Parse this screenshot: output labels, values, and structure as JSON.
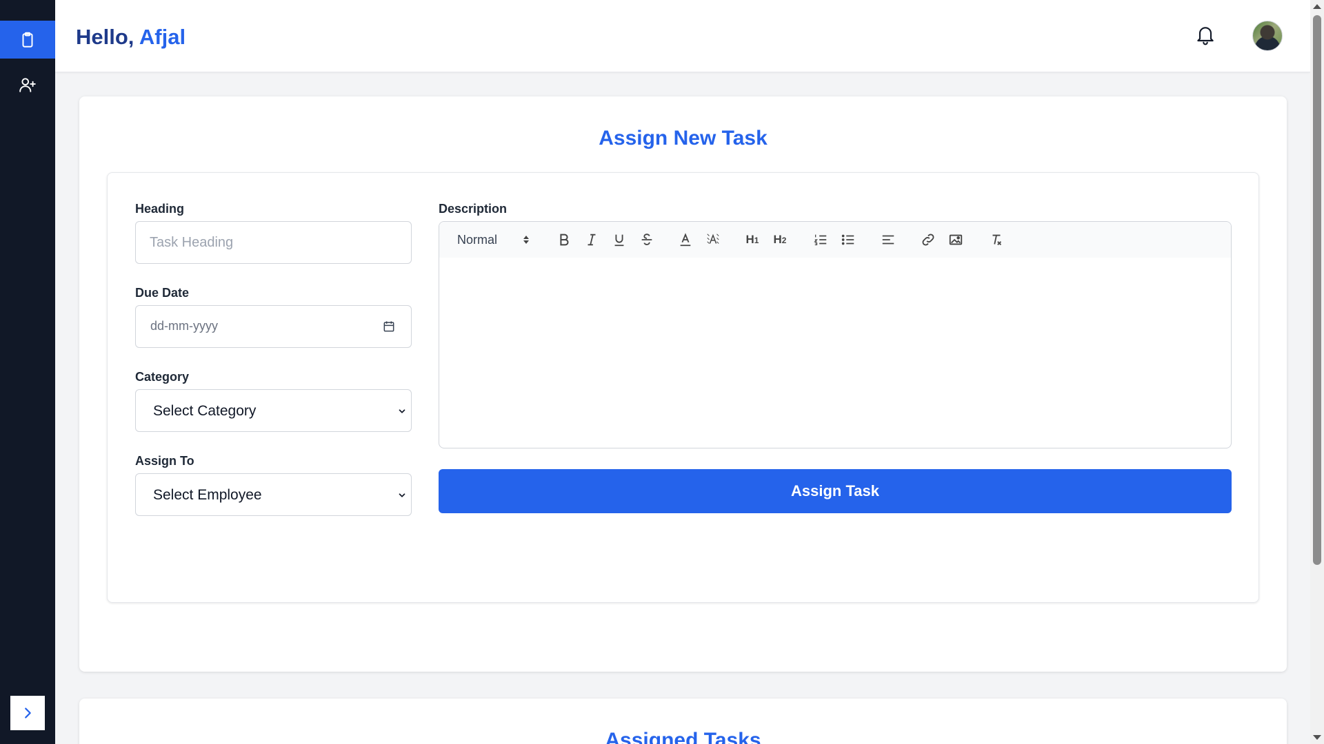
{
  "header": {
    "greeting_prefix": "Hello,",
    "user_name": "Afjal"
  },
  "sidebar": {
    "items": [
      {
        "name": "tasks",
        "icon": "clipboard-icon",
        "active": true
      },
      {
        "name": "add-user",
        "icon": "user-plus-icon",
        "active": false
      }
    ],
    "toggle_icon": "chevron-right-icon"
  },
  "form": {
    "title": "Assign New Task",
    "heading": {
      "label": "Heading",
      "placeholder": "Task Heading",
      "value": ""
    },
    "due_date": {
      "label": "Due Date",
      "placeholder": "dd-mm-yyyy"
    },
    "category": {
      "label": "Category",
      "selected": "Select Category"
    },
    "assign_to": {
      "label": "Assign To",
      "selected": "Select Employee"
    },
    "description": {
      "label": "Description",
      "toolbar": {
        "format": "Normal",
        "buttons": [
          "bold",
          "italic",
          "underline",
          "strike",
          "color",
          "background",
          "header-1",
          "header-2",
          "ordered-list",
          "bullet-list",
          "align",
          "link",
          "image",
          "clean"
        ]
      }
    },
    "submit_label": "Assign Task"
  },
  "assigned": {
    "title": "Assigned Tasks"
  },
  "colors": {
    "primary": "#2563eb",
    "sidebar_bg": "#111827",
    "greeting": "#1e3a8a"
  }
}
